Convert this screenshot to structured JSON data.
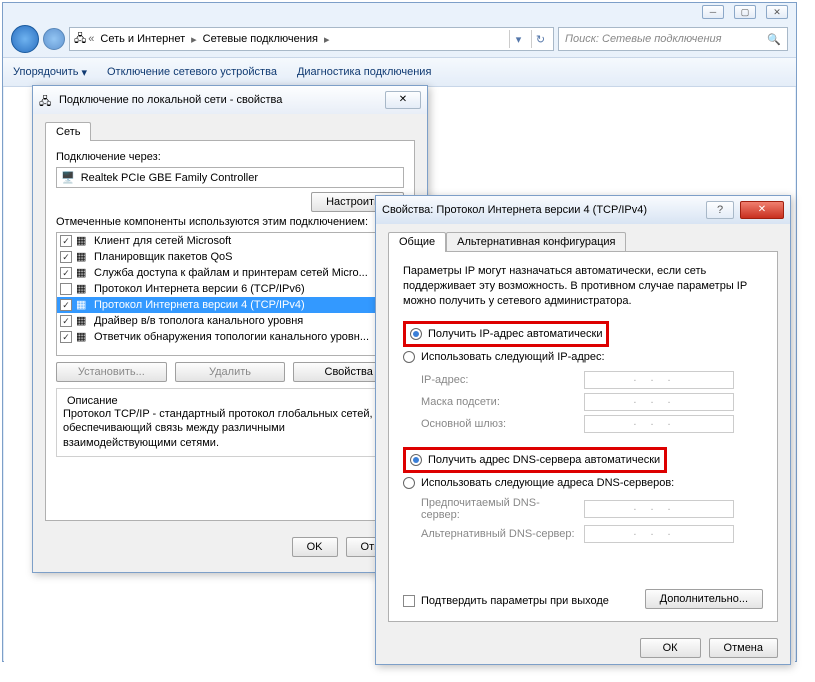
{
  "explorer": {
    "breadcrumb": [
      "Сеть и Интернет",
      "Сетевые подключения"
    ],
    "search_placeholder": "Поиск: Сетевые подключения",
    "toolbar": [
      "Упорядочить",
      "Отключение сетевого устройства",
      "Диагностика подключения"
    ]
  },
  "dlg1": {
    "title": "Подключение по локальной сети - свойства",
    "tab": "Сеть",
    "connect_via": "Подключение через:",
    "adapter": "Realtek PCIe GBE Family Controller",
    "configure": "Настроить...",
    "components_label": "Отмеченные компоненты используются этим подключением:",
    "items": [
      {
        "checked": true,
        "label": "Клиент для сетей Microsoft"
      },
      {
        "checked": true,
        "label": "Планировщик пакетов QoS"
      },
      {
        "checked": true,
        "label": "Служба доступа к файлам и принтерам сетей Micro..."
      },
      {
        "checked": false,
        "label": "Протокол Интернета версии 6 (TCP/IPv6)"
      },
      {
        "checked": true,
        "label": "Протокол Интернета версии 4 (TCP/IPv4)",
        "sel": true
      },
      {
        "checked": true,
        "label": "Драйвер в/в тополога канального уровня"
      },
      {
        "checked": true,
        "label": "Ответчик обнаружения топологии канального уровн..."
      }
    ],
    "install": "Установить...",
    "uninstall": "Удалить",
    "properties": "Свойства",
    "desc_title": "Описание",
    "desc": "Протокол TCP/IP - стандартный протокол глобальных сетей, обеспечивающий связь между различными взаимодействующими сетями.",
    "ok": "OK",
    "cancel": "Отмена"
  },
  "dlg2": {
    "title": "Свойства: Протокол Интернета версии 4 (TCP/IPv4)",
    "tab_general": "Общие",
    "tab_alt": "Альтернативная конфигурация",
    "intro": "Параметры IP могут назначаться автоматически, если сеть поддерживает эту возможность. В противном случае параметры IP можно получить у сетевого администратора.",
    "ip_auto": "Получить IP-адрес автоматически",
    "ip_manual": "Использовать следующий IP-адрес:",
    "ip_addr": "IP-адрес:",
    "ip_mask": "Маска подсети:",
    "ip_gw": "Основной шлюз:",
    "dns_auto": "Получить адрес DNS-сервера автоматически",
    "dns_manual": "Использовать следующие адреса DNS-серверов:",
    "dns_pref": "Предпочитаемый DNS-сервер:",
    "dns_alt": "Альтернативный DNS-сервер:",
    "confirm": "Подтвердить параметры при выходе",
    "advanced": "Дополнительно...",
    "ok": "ОК",
    "cancel": "Отмена"
  }
}
